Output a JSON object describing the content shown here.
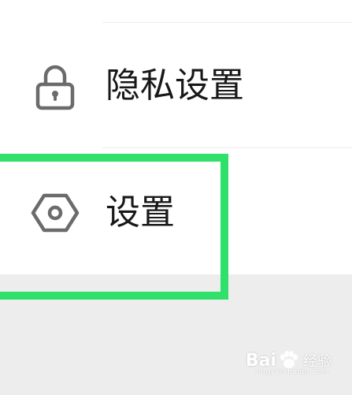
{
  "menu": {
    "items": [
      {
        "label": "隐私设置",
        "icon": "lock-icon"
      },
      {
        "label": "设置",
        "icon": "settings-hexagon-icon"
      }
    ]
  },
  "colors": {
    "highlight": "#2fe06a",
    "background": "#ededed",
    "panel": "#ffffff",
    "icon": "#6b6b6b",
    "text": "#181818"
  },
  "watermark": {
    "brand": "Bai",
    "brand_suffix": "经验",
    "site": "jingyan.baidu.com"
  }
}
